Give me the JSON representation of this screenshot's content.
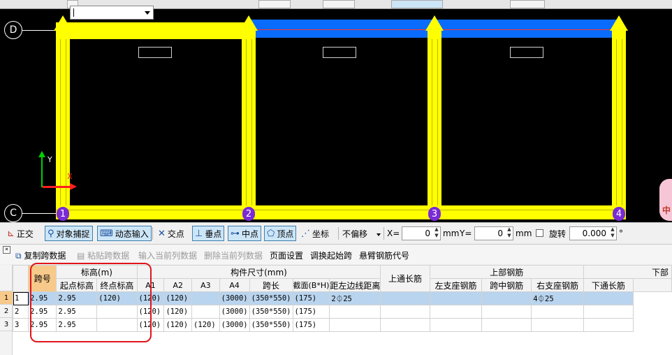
{
  "canvas": {
    "axis_rows": [
      "D",
      "C"
    ],
    "axis_cols": [
      "1",
      "2",
      "3",
      "4"
    ],
    "ucs_x": "X",
    "ucs_y": "Y",
    "side_char": "中"
  },
  "snapbar": {
    "ortho": "正交",
    "object_snap": "对象捕捉",
    "dynamic_input": "动态输入",
    "intersection": "交点",
    "perpendicular": "垂点",
    "midpoint": "中点",
    "endpoint": "顶点",
    "coordinate": "坐标",
    "offset_mode": "不偏移",
    "x_label": "X=",
    "x_value": "0",
    "y_label": "Y=",
    "y_value": "0",
    "unit": "mm",
    "rotate_label": "旋转",
    "rotate_value": "0.000",
    "degree": "°"
  },
  "actionbar": {
    "copy": "复制跨数据",
    "paste": "粘贴跨数据",
    "input_col": "输入当前列数据",
    "delete_col": "删除当前列数据",
    "page_setup": "页面设置",
    "swap_start": "调换起始跨",
    "cantilever": "悬臂钢筋代号"
  },
  "grid": {
    "group_headers": {
      "elevation": "标高(m)",
      "dimensions": "构件尺寸(mm)",
      "top_rebar": "上部钢筋",
      "bottom": "下部"
    },
    "headers": {
      "span": "跨号",
      "start_elev": "起点标高",
      "end_elev": "终点标高",
      "a1": "A1",
      "a2": "A2",
      "a3": "A3",
      "a4": "A4",
      "span_len": "跨长",
      "section": "截面(B*H)",
      "edge_dist": "距左边线距离",
      "top_through": "上通长筋",
      "left_support": "左支座钢筋",
      "mid_span": "跨中钢筋",
      "right_support": "右支座钢筋",
      "bottom_through": "下通长筋"
    },
    "row_numbers": [
      "1",
      "2",
      "3"
    ],
    "rows": [
      {
        "span": "1",
        "start": "2.95",
        "end": "2.95",
        "a1": "(120)",
        "a2": "(120)",
        "a3": "(120)",
        "a4": "",
        "len": "(3000)",
        "sec": "(350*550)",
        "dist": "(175)",
        "top": "2⏀25",
        "ls": "",
        "mid": "",
        "rs": "",
        "bot": "4⏀25"
      },
      {
        "span": "2",
        "start": "2.95",
        "end": "2.95",
        "a1": "",
        "a2": "(120)",
        "a3": "(120)",
        "a4": "",
        "len": "(3000)",
        "sec": "(350*550)",
        "dist": "(175)",
        "top": "",
        "ls": "",
        "mid": "",
        "rs": "",
        "bot": ""
      },
      {
        "span": "3",
        "start": "2.95",
        "end": "2.95",
        "a1": "",
        "a2": "(120)",
        "a3": "(120)",
        "a4": "(120)",
        "len": "(3000)",
        "sec": "(350*550)",
        "dist": "(175)",
        "top": "",
        "ls": "",
        "mid": "",
        "rs": "",
        "bot": ""
      }
    ]
  },
  "colors": {
    "beam_yellow": "#ffff00",
    "beam_selected_blue": "#0a6cff",
    "highlight_red": "#e0151b",
    "selection_row": "#b9d4ee"
  }
}
